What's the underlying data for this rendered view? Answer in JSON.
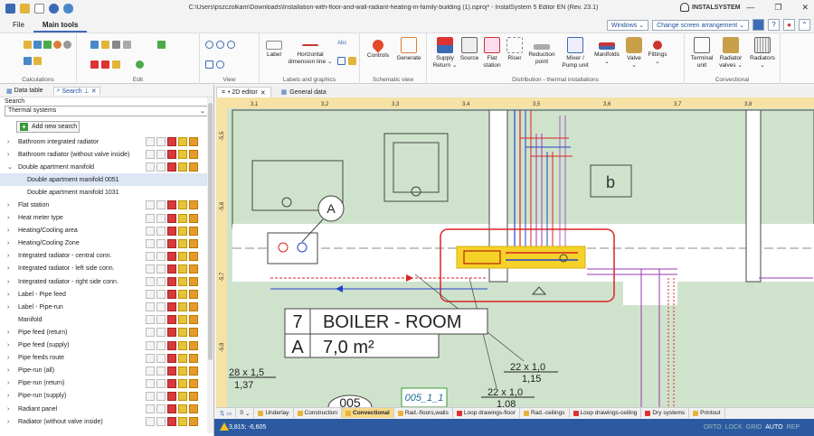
{
  "window": {
    "title": "C:\\Users\\pszczolkam\\Downloads\\Installation-with-floor-and-wall-radiant-heating-in-family-building (1).isproj* - InstalSystem 5 Editor EN (Rev. 23.1)",
    "brand": "INSTALSYSTEM",
    "min": "—",
    "max": "❐",
    "close": "✕"
  },
  "menu": {
    "file": "File",
    "main_tools": "Main tools",
    "windows": "Windows ⌄",
    "change_screen": "Change screen arrangement ⌄",
    "collapse": "⌃"
  },
  "ribbon": {
    "groups": {
      "calculations": "Calculations",
      "edit": "Edit",
      "view": "View",
      "labels_graphics": "Labels and graphics",
      "schematic_view": "Schematic view",
      "distribution": "Distribution - thermal installations",
      "convectional": "Convectional"
    },
    "buttons": {
      "label": "Label",
      "horizontal_dimension": "Horizontal dimension line ⌄",
      "controls": "Controls",
      "generate": "Generate",
      "supply_return": "Supply Return ⌄",
      "source": "Source",
      "flat_station": "Flat station",
      "riser": "Riser",
      "reduction_point": "Reduction point",
      "mixer_pump": "Mixer / Pump unit",
      "manifolds": "Manifolds ⌄",
      "valve": "Valve ⌄",
      "fittings": "Fittings ⌄",
      "terminal_unit": "Terminal unit",
      "radiator_valves": "Radiator valves ⌄",
      "radiators": "Radiators ⌄"
    }
  },
  "left_panel": {
    "tabs": {
      "data_table": "Data table",
      "search": "Search"
    },
    "search_label": "Search",
    "category": "Thermal systems",
    "add_search": "Add new search",
    "items": [
      {
        "label": "Bathroom integrated radiator",
        "expanded": false
      },
      {
        "label": "Bathroom radiator (without valve inside)",
        "expanded": false
      },
      {
        "label": "Double apartment manifold",
        "expanded": true
      },
      {
        "label": "Double apartment manifold 0051",
        "child": true,
        "selected": true
      },
      {
        "label": "Double apartment manifold 1031",
        "child": true
      },
      {
        "label": "Flat station",
        "expanded": false
      },
      {
        "label": "Heat meter type",
        "expanded": false
      },
      {
        "label": "Heating/Cooling area",
        "expanded": false
      },
      {
        "label": "Heating/Cooling Zone",
        "expanded": false
      },
      {
        "label": "Integrated radiator - central conn.",
        "expanded": false
      },
      {
        "label": "Integrated radiator - left side conn.",
        "expanded": false
      },
      {
        "label": "Integrated radiator - right side conn.",
        "expanded": false
      },
      {
        "label": "Label - Pipe feed",
        "expanded": false
      },
      {
        "label": "Label - Pipe-run",
        "expanded": false
      },
      {
        "label": "Manifold",
        "leaf": true
      },
      {
        "label": "Pipe feed (return)",
        "expanded": false
      },
      {
        "label": "Pipe feed (supply)",
        "expanded": false
      },
      {
        "label": "Pipe feeds route",
        "expanded": false
      },
      {
        "label": "Pipe-run (all)",
        "expanded": false
      },
      {
        "label": "Pipe-run (return)",
        "expanded": false
      },
      {
        "label": "Pipe-run (supply)",
        "expanded": false
      },
      {
        "label": "Radiant panel",
        "expanded": false
      },
      {
        "label": "Radiator (without valve inside)",
        "expanded": false
      }
    ]
  },
  "doc_tabs": {
    "editor": "• 2D editor",
    "general": "General data"
  },
  "canvas": {
    "ruler_x": [
      "3,1",
      "3,2",
      "3,3",
      "3,4",
      "3,5",
      "3,6",
      "3,7",
      "3,8"
    ],
    "ruler_y": [
      "-5,5",
      "-5,6",
      "-5,7",
      "-5,8"
    ],
    "room_number": "7",
    "room_name": "BOILER - ROOM",
    "room_letter": "A",
    "room_area": "7,0 m²",
    "label_a": "A",
    "label_b": "b",
    "pipe1": "22 x 1,0",
    "pipe1_len": "1,15",
    "pipe2": "22 x 1,0",
    "pipe2_len": "1,08",
    "pipe3": "28 x 1,5",
    "pipe3_len": "1,37",
    "tag": "005_1_1",
    "num": "005"
  },
  "bottom_tabs": {
    "zoom": "0",
    "underlay": "Underlay",
    "construction": "Construction",
    "convectional": "Convectional",
    "rad_floors": "Rad.-floors,walls",
    "loop_floor": "Loop drawings-floor",
    "rad_ceilings": "Rad.-ceilings",
    "loop_ceiling": "Loop drawings-ceiling",
    "dry": "Dry systems",
    "printout": "Printout"
  },
  "status": {
    "coords": "3,815; -6,605",
    "orto": "ORTO",
    "lock": "LOCK",
    "grid": "GRID",
    "auto": "AUTO",
    "rep": "REP"
  },
  "colors": {
    "accent": "#2c5aa0",
    "canvas_bg": "#cfe3cc",
    "highlight": "#f4d228",
    "supply": "#d22",
    "return": "#2244cc"
  }
}
